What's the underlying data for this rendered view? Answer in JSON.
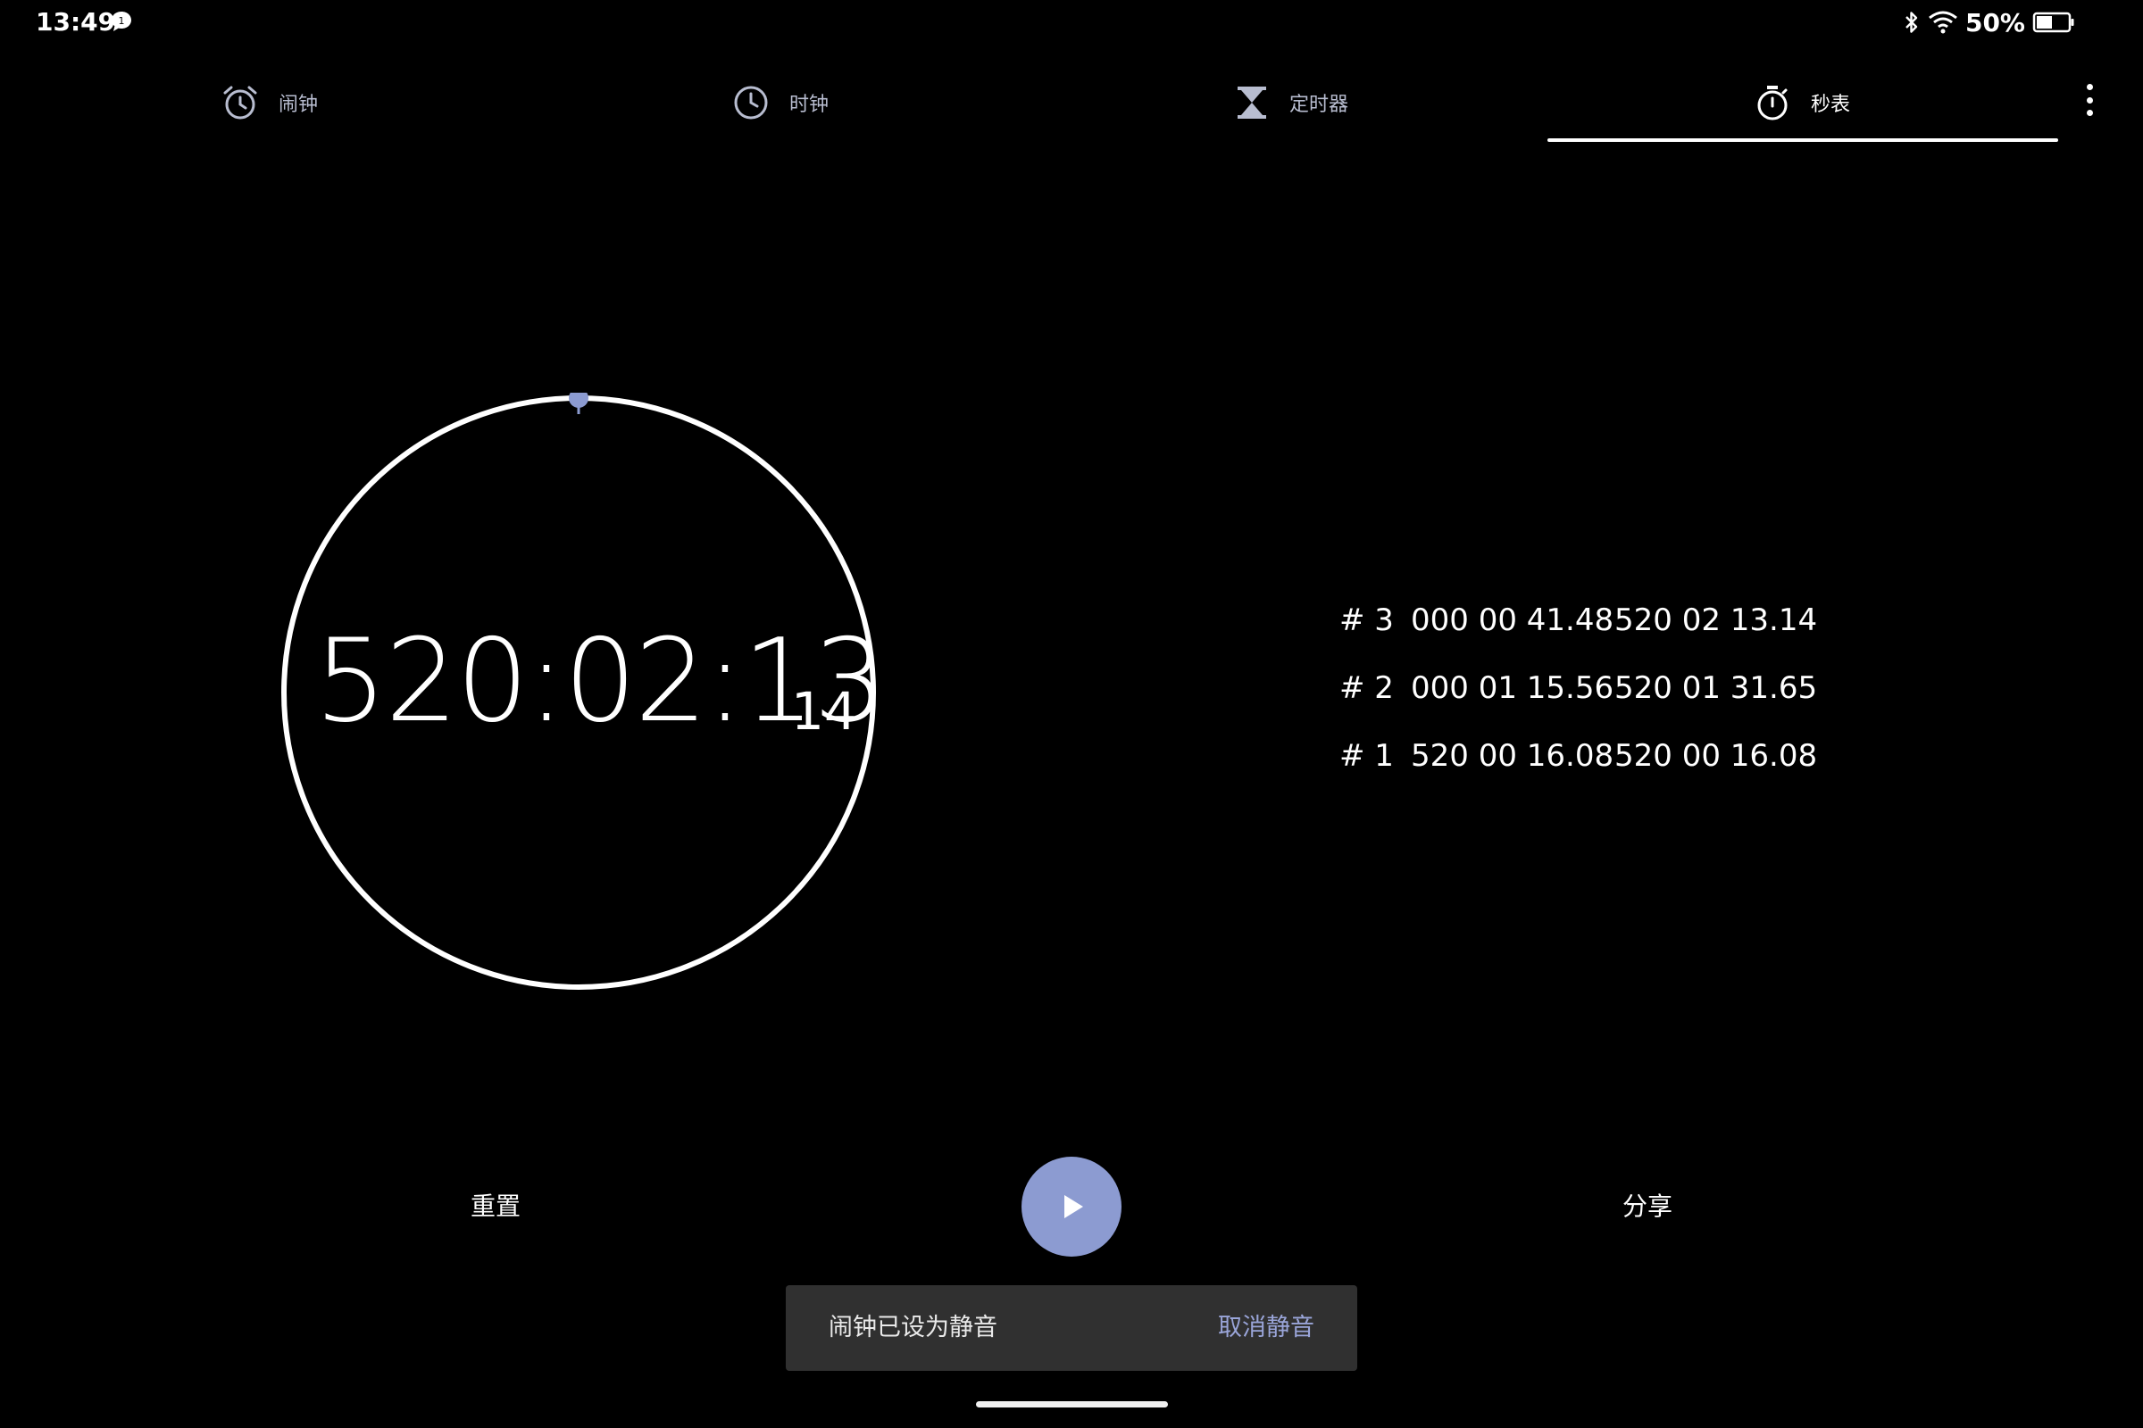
{
  "status_bar": {
    "time": "13:49",
    "notification_count": "1",
    "battery_percent": "50%",
    "icons": [
      "message-icon",
      "bluetooth-icon",
      "wifi-icon",
      "battery-icon"
    ]
  },
  "tabs": [
    {
      "label": "闹钟",
      "icon": "alarm-icon"
    },
    {
      "label": "时钟",
      "icon": "clock-icon"
    },
    {
      "label": "定时器",
      "icon": "hourglass-icon"
    },
    {
      "label": "秒表",
      "icon": "stopwatch-icon",
      "active": true
    }
  ],
  "stopwatch": {
    "elapsed_main": "520:02:13",
    "elapsed_centiseconds": "14",
    "accent_color": "#8c9bd1"
  },
  "laps": [
    {
      "number": "# 3",
      "split": "000 00 41.48",
      "total": "520 02 13.14"
    },
    {
      "number": "# 2",
      "split": "000 01 15.56",
      "total": "520 01 31.65"
    },
    {
      "number": "# 1",
      "split": "520 00 16.08",
      "total": "520 00 16.08"
    }
  ],
  "controls": {
    "reset_label": "重置",
    "share_label": "分享",
    "play_icon": "play-icon"
  },
  "snackbar": {
    "message": "闹钟已设为静音",
    "action": "取消静音"
  }
}
